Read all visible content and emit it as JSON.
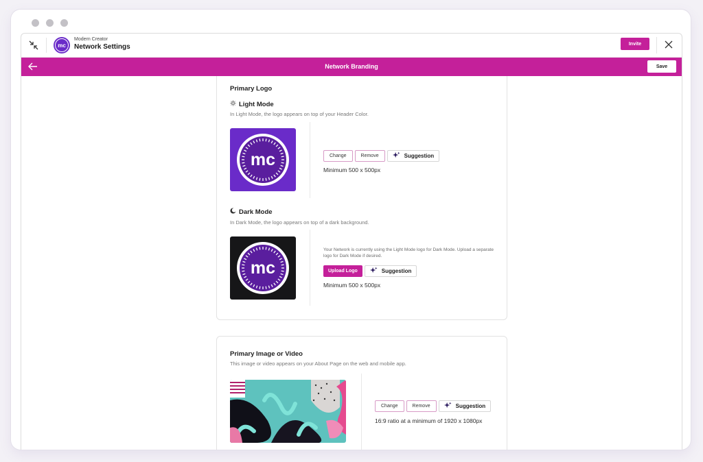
{
  "header": {
    "org_name": "Modern Creator",
    "title": "Network Settings",
    "avatar_text": "mc",
    "invite_label": "Invite"
  },
  "subheader": {
    "title": "Network Branding",
    "save_label": "Save"
  },
  "primary_logo": {
    "heading": "Primary Logo",
    "light_mode": {
      "title": "Light Mode",
      "description": "In Light Mode, the logo appears on top of your Header Color.",
      "logo_text": "mc",
      "change_label": "Change",
      "remove_label": "Remove",
      "suggestion_label": "Suggestion",
      "requirement": "Minimum 500 x 500px"
    },
    "dark_mode": {
      "title": "Dark Mode",
      "description": "In Dark Mode, the logo appears on top of a dark background.",
      "logo_text": "mc",
      "note": "Your Network is currently using the Light Mode logo for Dark Mode. Upload a separate logo for Dark Mode if desired.",
      "upload_label": "Upload Logo",
      "suggestion_label": "Suggestion",
      "requirement": "Minimum 500 x 500px"
    }
  },
  "primary_media": {
    "heading": "Primary Image or Video",
    "description": "This image or video appears on your About Page on the web and mobile app.",
    "change_label": "Change",
    "remove_label": "Remove",
    "suggestion_label": "Suggestion",
    "requirement": "16:9 ratio at a minimum of 1920 x 1080px"
  },
  "colors": {
    "brand": "#c4209a",
    "logo_purple": "#6a2bc9",
    "dark_tile": "#161618"
  }
}
